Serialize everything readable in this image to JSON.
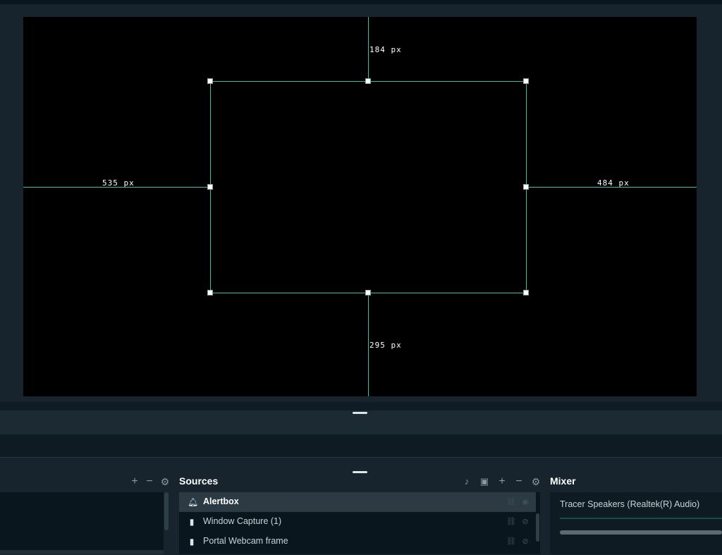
{
  "preview": {
    "measure_top": "184 px",
    "measure_left": "535 px",
    "measure_right": "484 px",
    "measure_bottom": "295 px"
  },
  "scenes": {
    "add_icon": "plus-icon",
    "remove_icon": "minus-icon",
    "settings_icon": "gear-icon"
  },
  "sources": {
    "title": "Sources",
    "items": [
      {
        "label": "Alertbox",
        "icon": "bell-icon",
        "selected": true
      },
      {
        "label": "Window Capture (1)",
        "icon": "file-icon",
        "selected": false
      },
      {
        "label": "Portal Webcam frame",
        "icon": "image-file-icon",
        "selected": false
      }
    ]
  },
  "mixer": {
    "title": "Mixer",
    "source_label": "Tracer Speakers (Realtek(R) Audio)"
  },
  "colors": {
    "accent": "#31c3a2",
    "background": "#17242d",
    "list_bg": "#09161d"
  }
}
